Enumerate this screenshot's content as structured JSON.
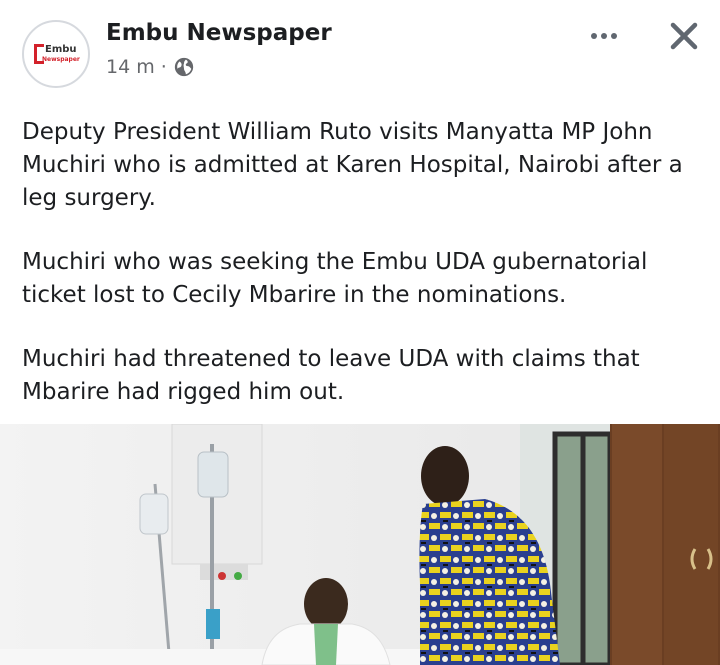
{
  "post": {
    "page_name": "Embu Newspaper",
    "avatar_logo_line1": "Embu",
    "avatar_logo_line2": "Newspaper",
    "time": "14 m",
    "separator": "·",
    "audience_icon": "globe-icon",
    "more_icon": "more-dots-icon",
    "close_icon": "close-icon",
    "paragraphs": [
      "Deputy President William Ruto visits Manyatta MP John Muchiri who is admitted at Karen Hospital, Nairobi after a leg surgery.",
      "Muchiri who was seeking the Embu UDA gubernatorial ticket lost to Cecily Mbarire in the nominations.",
      "Muchiri had threatened to leave UDA with claims that Mbarire had rigged him out."
    ]
  },
  "colors": {
    "text": "#1c1e21",
    "secondary": "#65676b",
    "logo_red": "#d3212a"
  }
}
